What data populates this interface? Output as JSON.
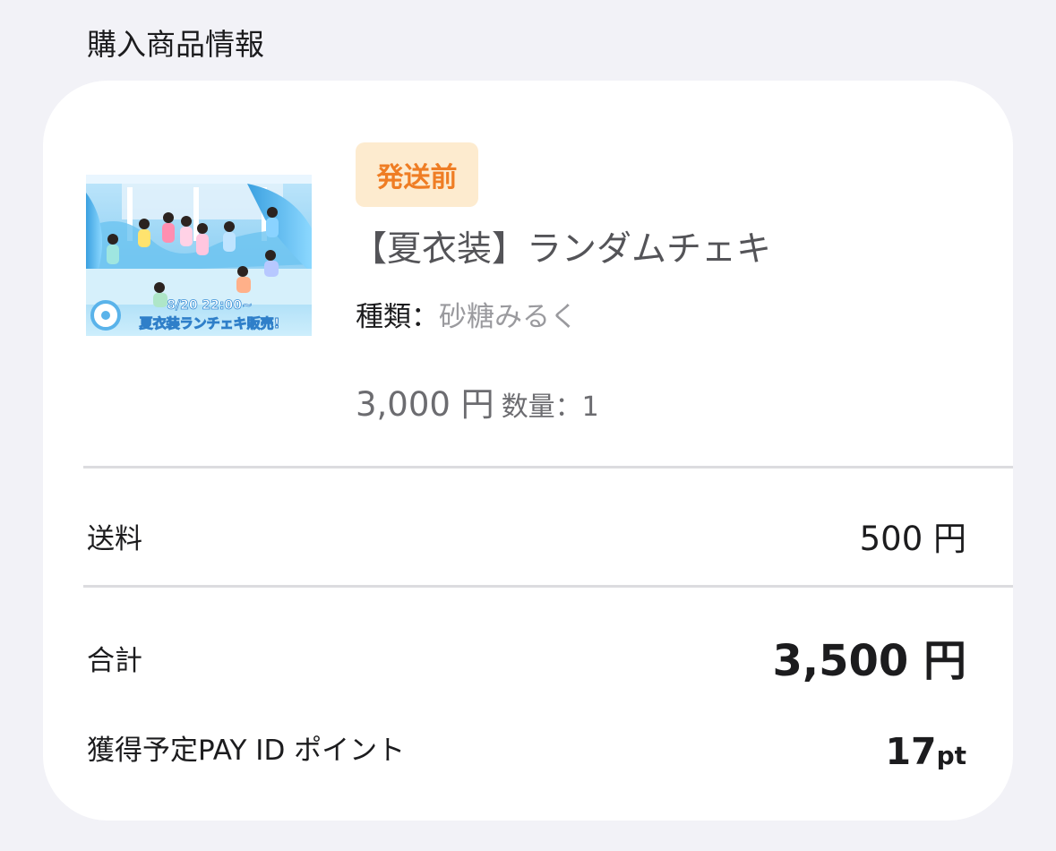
{
  "section_title": "購入商品情報",
  "item": {
    "status_badge": "発送前",
    "name": "【夏衣装】ランダムチェキ",
    "variant_label": "種類：",
    "variant_value": "砂糖みるく",
    "price": "3,000 円",
    "quantity_label": "数量：1",
    "thumbnail": {
      "line1": "8/20 22:00~",
      "line2": "夏衣装ランチェキ販売!"
    }
  },
  "summary": {
    "shipping_label": "送料",
    "shipping_value": "500 円",
    "total_label": "合計",
    "total_value": "3,500 円",
    "points_label": "獲得予定PAY ID ポイント",
    "points_value": "17",
    "points_unit": "pt"
  },
  "colors": {
    "badge_bg": "#fdebcf",
    "badge_text": "#ef7d24",
    "page_bg": "#f2f2f7"
  }
}
